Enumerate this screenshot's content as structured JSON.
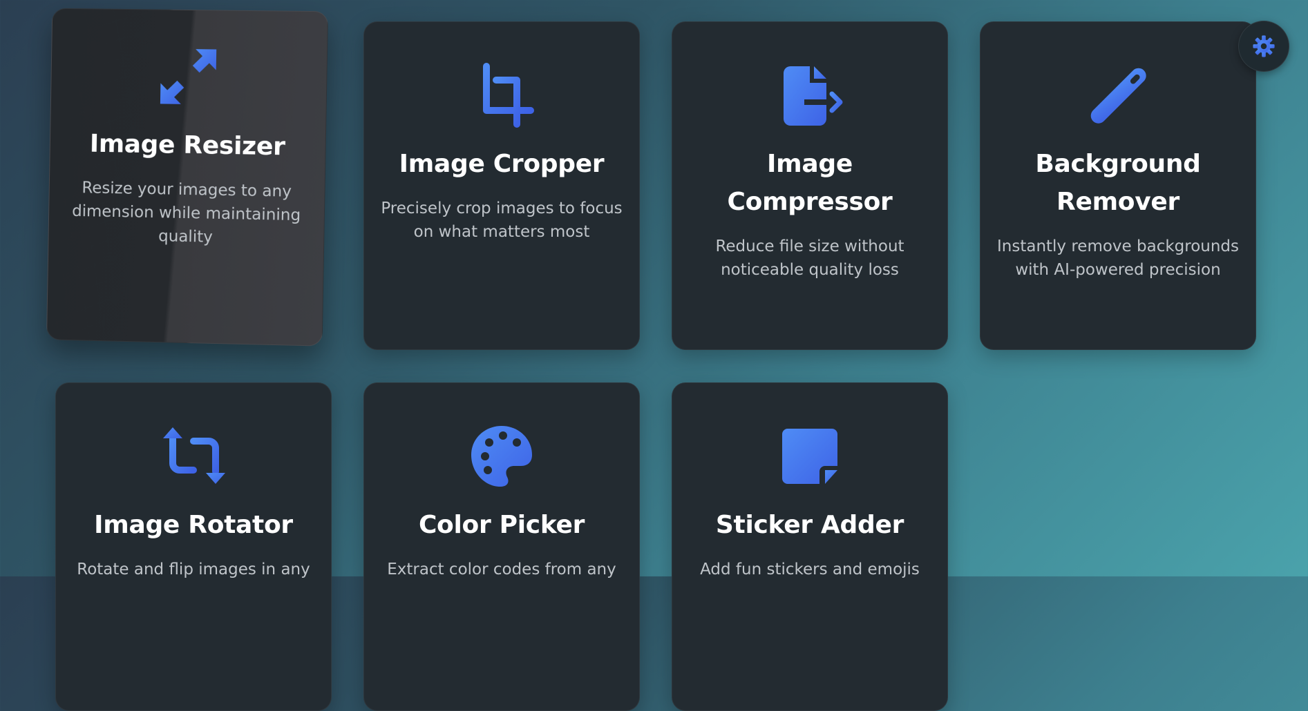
{
  "theme_toggle": {
    "icon": "gear-icon"
  },
  "colors": {
    "accent_start": "#4f8cf5",
    "accent_end": "#3e63e6",
    "card_bg": "#232b31",
    "title": "#ffffff",
    "desc": "#bfc4c9"
  },
  "tools": [
    {
      "icon": "resize-arrows-icon",
      "title": "Image Resizer",
      "description": "Resize your images to any dimension while maintaining quality"
    },
    {
      "icon": "crop-icon",
      "title": "Image Cropper",
      "description": "Precisely crop images to focus on what matters most"
    },
    {
      "icon": "file-export-icon",
      "title": "Image Compressor",
      "description": "Reduce file size without noticeable quality loss"
    },
    {
      "icon": "eraser-pen-icon",
      "title": "Background Remover",
      "description": "Instantly remove backgrounds with AI-powered precision"
    },
    {
      "icon": "rotate-arrows-icon",
      "title": "Image Rotator",
      "description": "Rotate and flip images in any"
    },
    {
      "icon": "palette-icon",
      "title": "Color Picker",
      "description": "Extract color codes from any"
    },
    {
      "icon": "sticky-note-icon",
      "title": "Sticker Adder",
      "description": "Add fun stickers and emojis"
    }
  ]
}
